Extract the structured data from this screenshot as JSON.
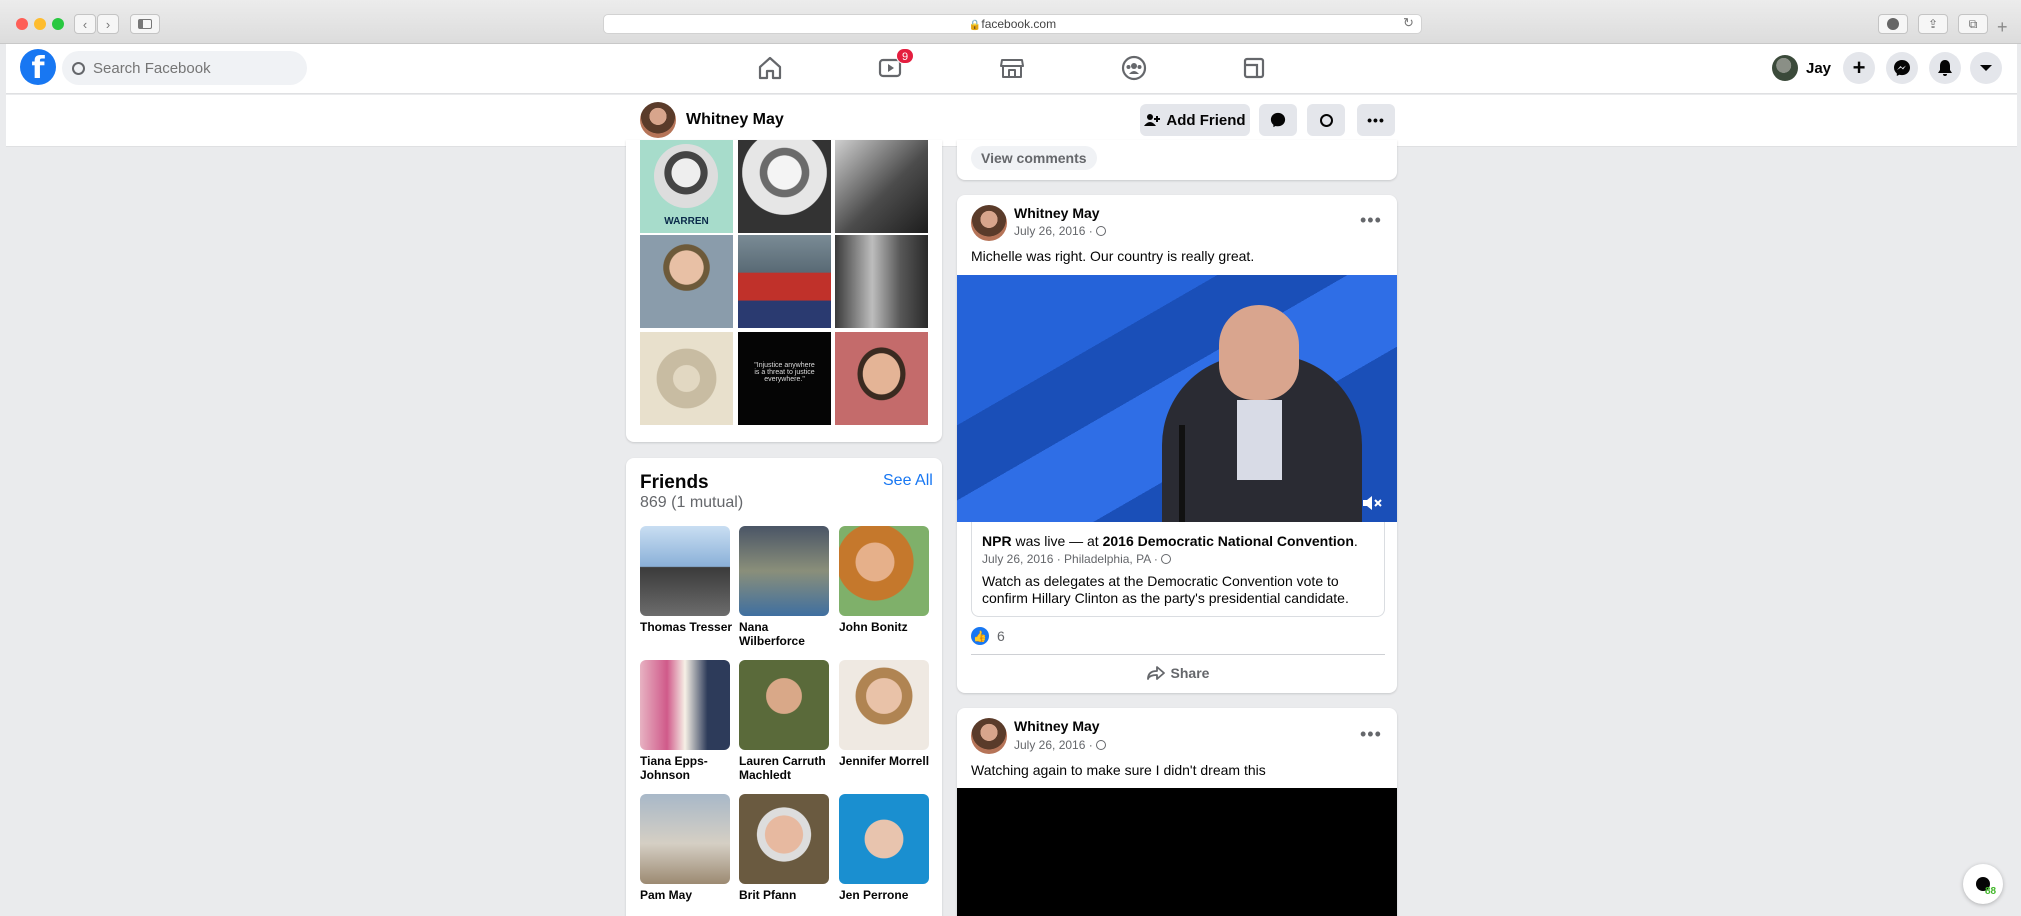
{
  "browser": {
    "url": "facebook.com"
  },
  "topbar": {
    "search_placeholder": "Search Facebook",
    "watch_badge": "9",
    "user_name": "Jay"
  },
  "profile_bar": {
    "name": "Whitney May",
    "add_friend": "Add Friend"
  },
  "top_card": {
    "view_comments": "View comments"
  },
  "friends": {
    "title": "Friends",
    "count": "869 (1 mutual)",
    "see_all": "See All",
    "items": [
      {
        "name": "Thomas Tresser"
      },
      {
        "name": "Nana Wilberforce"
      },
      {
        "name": "John Bonitz"
      },
      {
        "name": "Tiana Epps-Johnson"
      },
      {
        "name": "Lauren Carruth Machledt"
      },
      {
        "name": "Jennifer Morrell"
      },
      {
        "name": "Pam May"
      },
      {
        "name": "Brit Pfann"
      },
      {
        "name": "Jen Perrone"
      }
    ]
  },
  "photos": {
    "photo1_caption": "WARREN",
    "photo8_quote": "\"Injustice anywhere is a threat to justice everywhere.\""
  },
  "post1": {
    "author": "Whitney May",
    "date": "July 26, 2016 ·",
    "text": "Michelle was right. Our country is really great.",
    "shared": {
      "org": "NPR",
      "live": "was live — at",
      "event": "2016 Democratic National Convention",
      "period": ".",
      "meta": "July 26, 2016 · Philadelphia, PA ·",
      "desc": "Watch as delegates at the Democratic Convention vote to confirm Hillary Clinton as the party's presidential candidate."
    },
    "likes": "6",
    "share": "Share"
  },
  "post2": {
    "author": "Whitney May",
    "date": "July 26, 2016 ·",
    "text": "Watching again to make sure I didn't dream this"
  },
  "corner_badge": "88",
  "colors": {
    "brand": "#1877f2",
    "badge_red": "#e41e3f",
    "bg": "#f0f2f5"
  }
}
